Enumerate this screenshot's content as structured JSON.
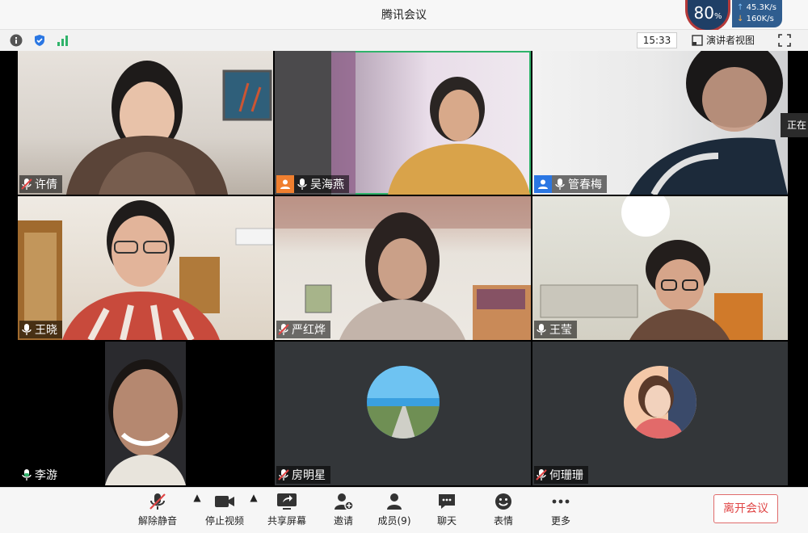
{
  "window": {
    "title": "腾讯会议"
  },
  "network": {
    "quality": "80",
    "quality_unit": "%",
    "upload": "45.3",
    "upload_unit": "K/s",
    "download": "160",
    "download_unit": "K/s"
  },
  "infobar": {
    "time": "15:33",
    "speaker_view_label": "演讲者视图"
  },
  "side_tag": "正在",
  "participants": [
    {
      "name": "许倩",
      "mic": "muted",
      "host": ""
    },
    {
      "name": "吴海燕",
      "mic": "on",
      "host": "orange"
    },
    {
      "name": "管春梅",
      "mic": "on",
      "host": "blue"
    },
    {
      "name": "王晓",
      "mic": "on",
      "host": ""
    },
    {
      "name": "严红烨",
      "mic": "muted",
      "host": ""
    },
    {
      "name": "王莹",
      "mic": "on",
      "host": ""
    },
    {
      "name": "李游",
      "mic": "speaking",
      "host": ""
    },
    {
      "name": "房明星",
      "mic": "muted",
      "host": ""
    },
    {
      "name": "何珊珊",
      "mic": "muted",
      "host": ""
    }
  ],
  "toolbar": {
    "unmute": "解除静音",
    "stop_video": "停止视频",
    "share_screen": "共享屏幕",
    "invite": "邀请",
    "members": "成员(9)",
    "chat": "聊天",
    "emoji": "表情",
    "more": "更多",
    "leave": "离开会议"
  },
  "colors": {
    "accent": "#2b77e3",
    "leave": "#e04545",
    "speaking": "#2fb36a"
  }
}
